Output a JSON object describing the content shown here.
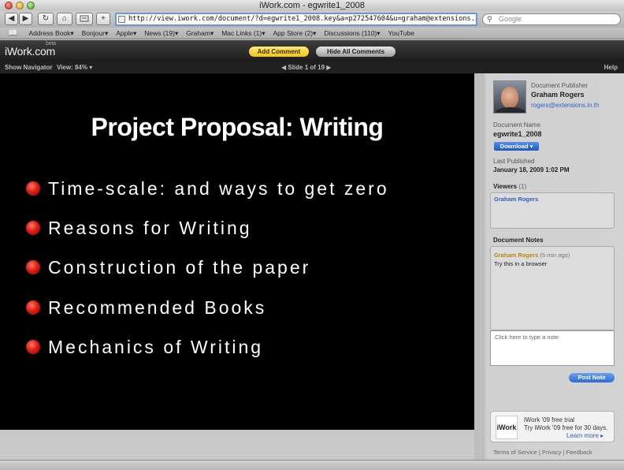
{
  "window": {
    "title": "iWork.com - egwrite1_2008"
  },
  "toolbar": {
    "url": "http://view.iwork.com/document/?d=egwrite1_2008.key&a=p272547604&u=graham@extensions.in.th&p=",
    "search_placeholder": "Google",
    "back_glyph": "◀",
    "forward_glyph": "▶",
    "reload_glyph": "↻",
    "home_glyph": "⌂",
    "add_glyph": "+"
  },
  "bookmarks": [
    "Address Book▾",
    "Bonjour▾",
    "Apple▾",
    "News (19)▾",
    "Graham▾",
    "Mac Links (1)▾",
    "App Store (2)▾",
    "Discussions (110)▾",
    "YouTube"
  ],
  "iwork": {
    "logo": "iWork.com",
    "beta": "beta",
    "add_comment": "Add Comment",
    "hide_comments": "Hide All Comments"
  },
  "navbar": {
    "show_navigator": "Show Navigator",
    "view": "View: 84% ▾",
    "slide_indicator": "◀  Slide 1 of 19  ▶",
    "help": "Help"
  },
  "slide": {
    "title": "Project Proposal:  Writing",
    "bullets": [
      "Time-scale: and ways to get zero",
      "Reasons for Writing",
      "Construction of the paper",
      "Recommended Books",
      "Mechanics of Writing"
    ]
  },
  "sidebar": {
    "publisher_label": "Document Publisher",
    "publisher_name": "Graham Rogers",
    "publisher_email": "rogers@extensions.in.th",
    "doc_name_label": "Document Name",
    "doc_name": "egwrite1_2008",
    "download": "Download ▾",
    "last_published_label": "Last Published",
    "last_published": "January 18, 2009 1:02 PM",
    "viewers_label": "Viewers",
    "viewers_count": "(1)",
    "viewer_name": "Graham Rogers",
    "notes_label": "Document Notes",
    "note_author": "Graham Rogers",
    "note_time": "(5 min ago)",
    "note_text": "Try this in a browser",
    "note_placeholder": "Click here to type a note",
    "post_note": "Post Note",
    "promo_logo": "iWork",
    "promo_title": "iWork '09 free trial",
    "promo_body": "Try iWork '09 free for 30 days.",
    "promo_link": "Learn more ▸",
    "footer": "Terms of Service | Privacy | Feedback"
  },
  "colors": {
    "accent_blue": "#2d6ad6",
    "comment_yellow": "#f2c41e",
    "bullet_red": "#e01c12",
    "note_author_color": "#b8860b"
  }
}
